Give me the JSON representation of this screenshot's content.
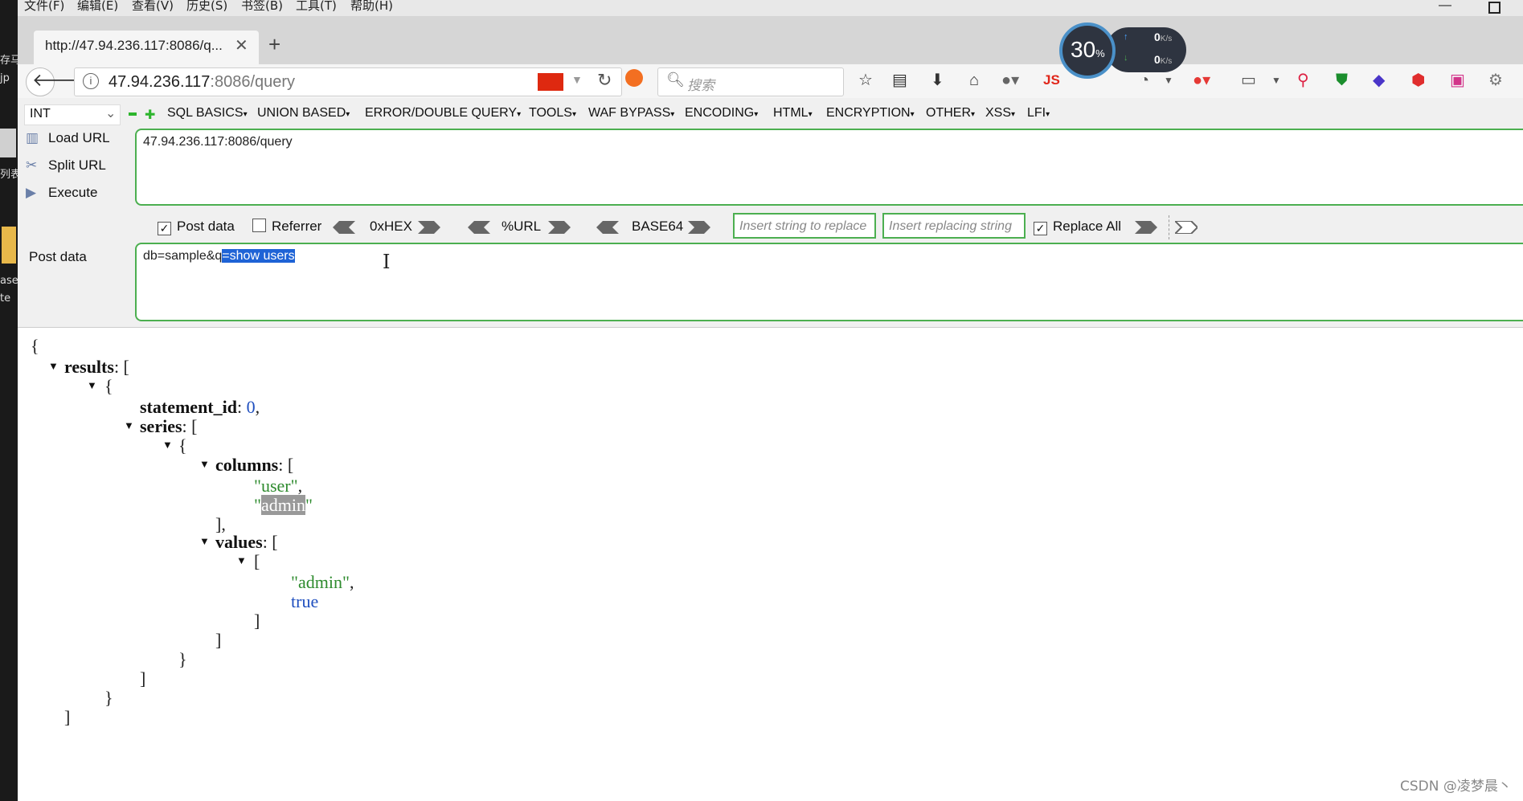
{
  "desktop": {
    "labels": [
      "存马",
      "jp",
      "列表",
      "ase",
      "te"
    ]
  },
  "menubar": {
    "items": [
      "文件(F)",
      "编辑(E)",
      "查看(V)",
      "历史(S)",
      "书签(B)",
      "工具(T)",
      "帮助(H)"
    ]
  },
  "tab": {
    "title": "http://47.94.236.117:8086/q...",
    "close": "✕",
    "new": "+"
  },
  "navbar": {
    "url_host": "47.94.236.117",
    "url_rest": ":8086/query",
    "search_placeholder": "搜索",
    "js_label": "JS"
  },
  "speed_widget": {
    "percent": "30",
    "percent_sign": "%",
    "up": "0",
    "down": "0",
    "unit": "K/s"
  },
  "hackbar": {
    "type": "INT",
    "menus": [
      "SQL BASICS",
      "UNION BASED",
      "ERROR/DOUBLE QUERY",
      "TOOLS",
      "WAF BYPASS",
      "ENCODING",
      "HTML",
      "ENCRYPTION",
      "OTHER",
      "XSS",
      "LFI"
    ],
    "load_url": "Load URL",
    "split_url": "Split URL",
    "execute": "Execute",
    "url_value": "47.94.236.117:8086/query",
    "post_data_checkbox": "Post data",
    "post_data_checked": true,
    "referrer": "Referrer",
    "referrer_checked": false,
    "hex": "0xHEX",
    "url_enc": "%URL",
    "base64": "BASE64",
    "insert_replace_ph": "Insert string to replace",
    "insert_replacing_ph": "Insert replacing string",
    "replace_all": "Replace All",
    "replace_all_checked": true,
    "post_label": "Post data",
    "post_plain": "db=sample&q",
    "post_selected": "=show users"
  },
  "json": {
    "open_brace": "{",
    "results_key": "results",
    "statement_id_key": "statement_id",
    "statement_id_val": "0",
    "series_key": "series",
    "columns_key": "columns",
    "col1": "\"user\"",
    "col2_q1": "\"",
    "col2": "admin",
    "col2_q2": "\"",
    "values_key": "values",
    "val1": "\"admin\"",
    "val2": "true"
  },
  "watermark": "CSDN @凌梦晨丶"
}
